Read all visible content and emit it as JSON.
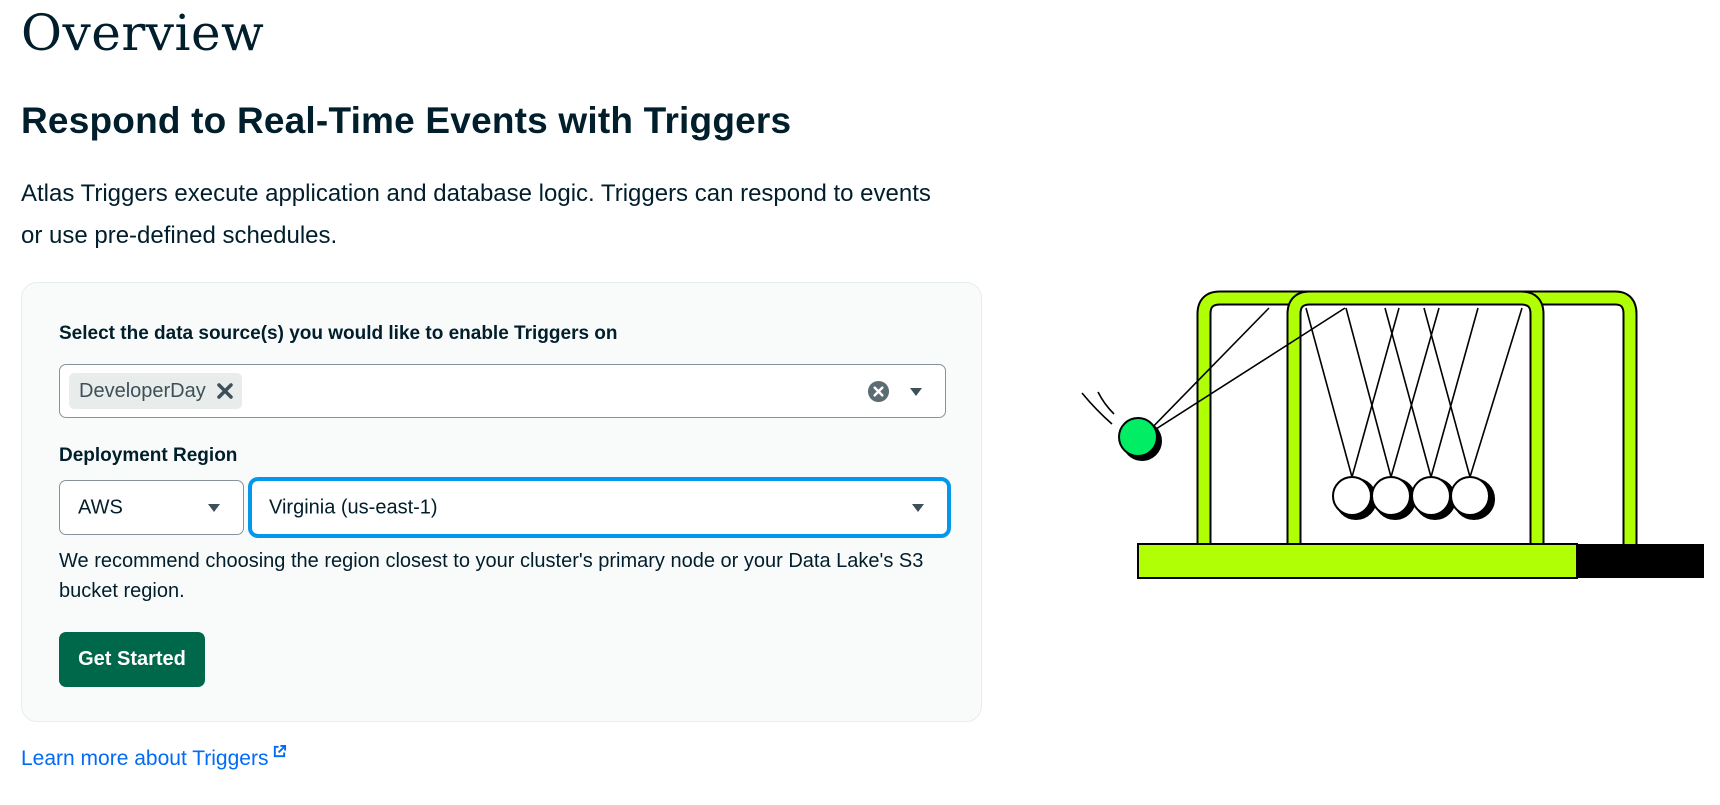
{
  "page": {
    "title": "Overview",
    "heading": "Respond to Real-Time Events with Triggers",
    "intro": "Atlas Triggers execute application and database logic. Triggers can respond to events or use pre-defined schedules."
  },
  "form": {
    "data_source_label": "Select the data source(s) you would like to enable Triggers on",
    "data_source_selected": [
      "DeveloperDay"
    ],
    "region_label": "Deployment Region",
    "provider_value": "AWS",
    "region_value": "Virginia (us-east-1)",
    "hint": "We recommend choosing the region closest to your cluster's primary node or your Data Lake's S3 bucket region.",
    "submit_label": "Get Started"
  },
  "footer": {
    "learn_more_label": "Learn more about Triggers"
  },
  "icons": {
    "chip_remove": "close-icon",
    "clear": "clear-circle-icon",
    "dropdown": "caret-down-icon",
    "external": "external-link-icon"
  },
  "colors": {
    "primary_button": "#00684a",
    "focus_ring": "#0498ec",
    "link": "#016bf8",
    "illustration_frame": "#b1ff05",
    "illustration_ball": "#00ed64"
  }
}
